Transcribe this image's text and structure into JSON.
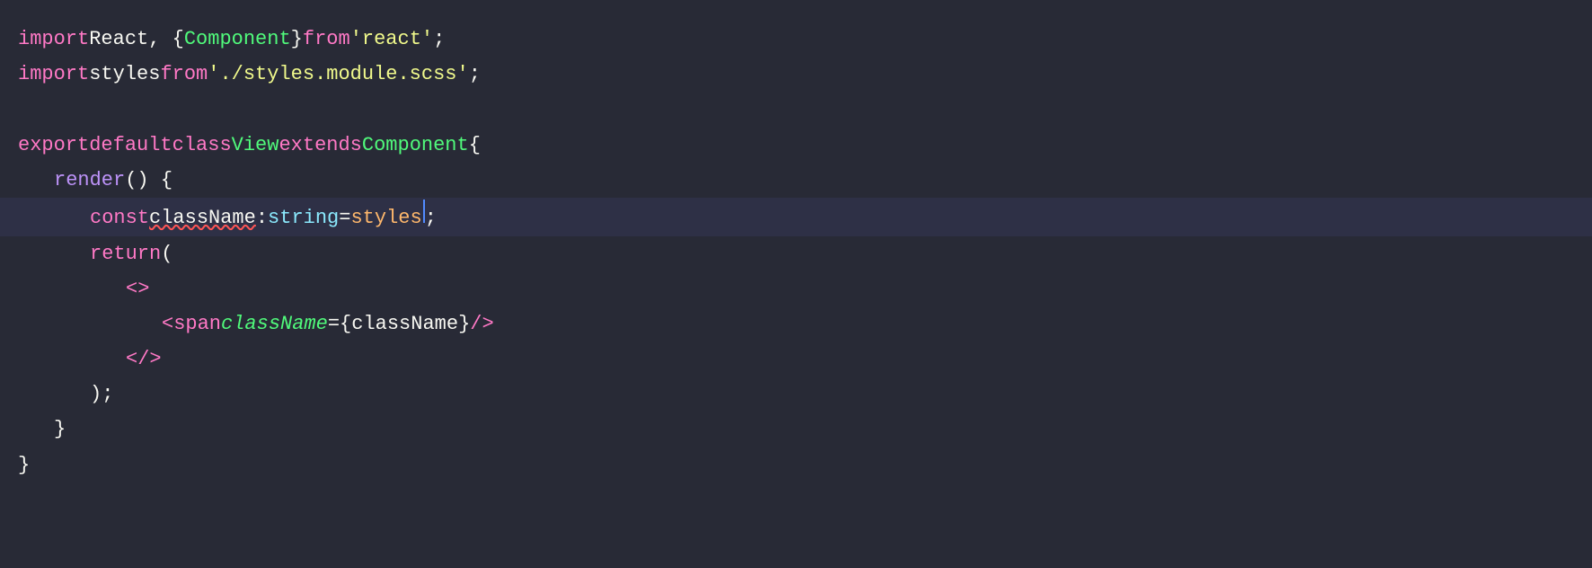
{
  "editor": {
    "background": "#282a36",
    "lines": [
      {
        "id": "line1",
        "indent": 0,
        "content": [
          {
            "type": "kw-import",
            "text": "import"
          },
          {
            "type": "plain",
            "text": " React, { "
          },
          {
            "type": "cls-name",
            "text": "Component"
          },
          {
            "type": "plain",
            "text": " } "
          },
          {
            "type": "kw-from",
            "text": "from"
          },
          {
            "type": "plain",
            "text": " "
          },
          {
            "type": "str",
            "text": "'react'"
          },
          {
            "type": "plain",
            "text": ";"
          }
        ]
      },
      {
        "id": "line2",
        "indent": 0,
        "content": [
          {
            "type": "kw-import",
            "text": "import"
          },
          {
            "type": "plain",
            "text": " styles "
          },
          {
            "type": "kw-from",
            "text": "from"
          },
          {
            "type": "plain",
            "text": " "
          },
          {
            "type": "str",
            "text": "'./styles.module.scss'"
          },
          {
            "type": "plain",
            "text": ";"
          }
        ]
      },
      {
        "id": "line3",
        "indent": 0,
        "content": []
      },
      {
        "id": "line4",
        "indent": 0,
        "content": [
          {
            "type": "kw-import",
            "text": "export"
          },
          {
            "type": "plain",
            "text": " "
          },
          {
            "type": "kw-import",
            "text": "default"
          },
          {
            "type": "plain",
            "text": " "
          },
          {
            "type": "kw-import",
            "text": "class"
          },
          {
            "type": "plain",
            "text": " "
          },
          {
            "type": "cls-name",
            "text": "View"
          },
          {
            "type": "plain",
            "text": " "
          },
          {
            "type": "kw-import",
            "text": "extends"
          },
          {
            "type": "plain",
            "text": " "
          },
          {
            "type": "cls-name",
            "text": "Component"
          },
          {
            "type": "plain",
            "text": " {"
          }
        ]
      },
      {
        "id": "line5",
        "indent": 1,
        "content": [
          {
            "type": "kw-purple",
            "text": "render"
          },
          {
            "type": "plain",
            "text": " () {"
          }
        ]
      },
      {
        "id": "line6",
        "indent": 2,
        "active": true,
        "content": [
          {
            "type": "kw-import",
            "text": "const"
          },
          {
            "type": "plain",
            "text": " "
          },
          {
            "type": "squiggle",
            "text": "className"
          },
          {
            "type": "plain",
            "text": ": "
          },
          {
            "type": "type-annot",
            "text": "string"
          },
          {
            "type": "plain",
            "text": " = "
          },
          {
            "type": "styles-ref",
            "text": "styles"
          },
          {
            "type": "cursor",
            "text": ""
          },
          {
            "type": "plain",
            "text": ";"
          }
        ]
      },
      {
        "id": "line7",
        "indent": 2,
        "content": [
          {
            "type": "kw-import",
            "text": "return"
          },
          {
            "type": "plain",
            "text": " ("
          }
        ]
      },
      {
        "id": "line8",
        "indent": 3,
        "content": [
          {
            "type": "tag-bracket",
            "text": "<>"
          }
        ]
      },
      {
        "id": "line9",
        "indent": 4,
        "content": [
          {
            "type": "tag-bracket",
            "text": "<"
          },
          {
            "type": "tag-name",
            "text": "span"
          },
          {
            "type": "plain",
            "text": " "
          },
          {
            "type": "attr-italic",
            "text": "className"
          },
          {
            "type": "plain",
            "text": "={"
          },
          {
            "type": "plain",
            "text": "className"
          },
          {
            "type": "plain",
            "text": "} />"
          }
        ]
      },
      {
        "id": "line10",
        "indent": 3,
        "content": [
          {
            "type": "tag-bracket",
            "text": "</>"
          }
        ]
      },
      {
        "id": "line11",
        "indent": 2,
        "content": [
          {
            "type": "plain",
            "text": ");"
          }
        ]
      },
      {
        "id": "line12",
        "indent": 1,
        "content": [
          {
            "type": "plain",
            "text": "}"
          }
        ]
      },
      {
        "id": "line13",
        "indent": 0,
        "content": [
          {
            "type": "plain",
            "text": "}"
          }
        ]
      }
    ]
  }
}
